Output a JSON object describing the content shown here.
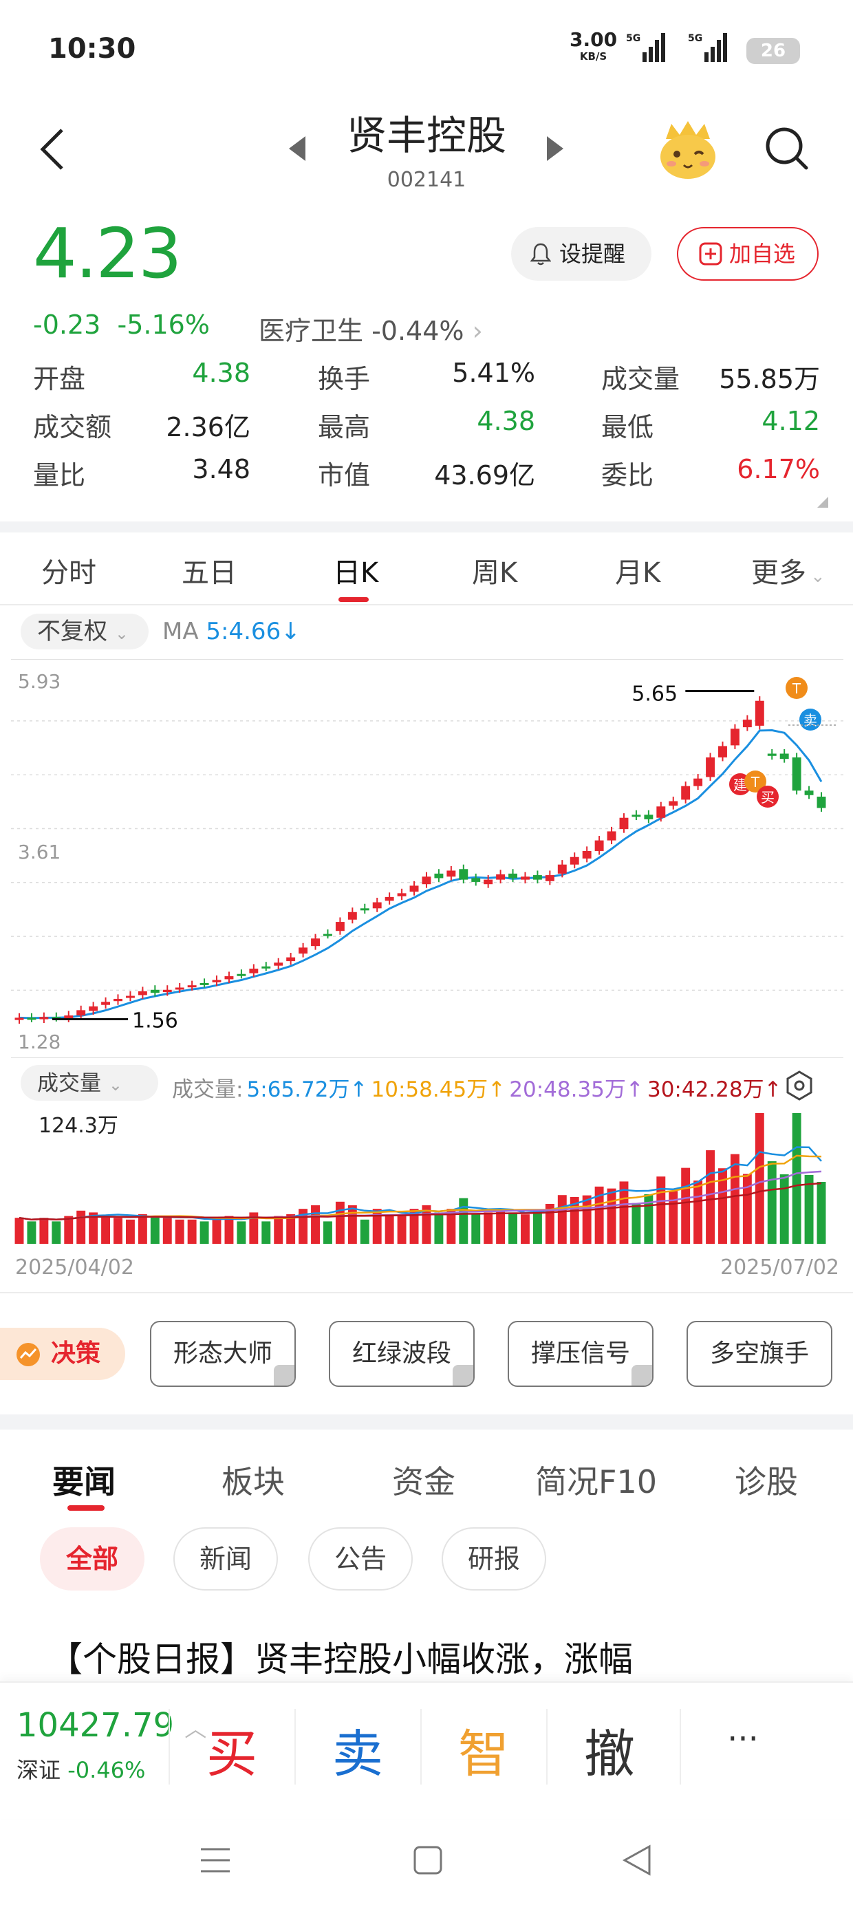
{
  "status_bar": {
    "time": "10:30",
    "speed": "3.00",
    "speed_unit": "KB/S",
    "net1": "5G",
    "net2": "5G",
    "battery": "26"
  },
  "header": {
    "title": "贤丰控股",
    "code": "002141"
  },
  "quote": {
    "price": "4.23",
    "change": "-0.23",
    "change_pct": "-5.16%",
    "sector": "医疗卫生 -0.44%",
    "remind_label": "设提醒",
    "add_label": "加自选"
  },
  "stats": [
    {
      "label": "开盘",
      "value": "4.38",
      "color": "#1fa33d"
    },
    {
      "label": "换手",
      "value": "5.41%",
      "color": "#222222"
    },
    {
      "label": "成交量",
      "value": "55.85万",
      "color": "#222222"
    },
    {
      "label": "成交额",
      "value": "2.36亿",
      "color": "#222222"
    },
    {
      "label": "最高",
      "value": "4.38",
      "color": "#1fa33d"
    },
    {
      "label": "最低",
      "value": "4.12",
      "color": "#1fa33d"
    },
    {
      "label": "量比",
      "value": "3.48",
      "color": "#222222"
    },
    {
      "label": "市值",
      "value": "43.69亿",
      "color": "#222222"
    },
    {
      "label": "委比",
      "value": "6.17%",
      "color": "#e5252e"
    }
  ],
  "period_tabs": [
    "分时",
    "五日",
    "日K",
    "周K",
    "月K",
    "更多"
  ],
  "active_period": "日K",
  "chart_controls": {
    "adjust": "不复权",
    "ma_label": "MA",
    "ma_value": "5:4.66↓"
  },
  "chart_data": {
    "type": "candlestick",
    "y_high_label": "5.93",
    "y_mid_label": "3.61",
    "y_low_label": "1.28",
    "ylim": [
      1.28,
      5.93
    ],
    "max_marker": "5.65",
    "min_marker": "1.56",
    "x_start": "2025/04/02",
    "x_end": "2025/07/02",
    "badges": [
      "T",
      "卖",
      "建",
      "T",
      "买"
    ],
    "close": [
      1.45,
      1.44,
      1.46,
      1.45,
      1.48,
      1.55,
      1.6,
      1.66,
      1.7,
      1.74,
      1.8,
      1.78,
      1.82,
      1.85,
      1.88,
      1.9,
      1.95,
      2.0,
      2.02,
      2.1,
      2.12,
      2.18,
      2.25,
      2.38,
      2.5,
      2.55,
      2.72,
      2.85,
      2.88,
      2.98,
      3.05,
      3.1,
      3.2,
      3.32,
      3.3,
      3.4,
      3.28,
      3.25,
      3.28,
      3.35,
      3.3,
      3.32,
      3.28,
      3.34,
      3.48,
      3.58,
      3.66,
      3.8,
      3.92,
      4.1,
      4.12,
      4.08,
      4.25,
      4.32,
      4.52,
      4.62,
      4.9,
      5.05,
      5.28,
      5.4,
      5.65,
      4.92,
      4.88,
      4.46,
      4.4,
      4.23
    ],
    "open": [
      1.42,
      1.45,
      1.43,
      1.46,
      1.44,
      1.48,
      1.54,
      1.62,
      1.67,
      1.72,
      1.75,
      1.82,
      1.79,
      1.83,
      1.86,
      1.91,
      1.92,
      1.96,
      2.03,
      2.04,
      2.13,
      2.14,
      2.2,
      2.3,
      2.4,
      2.56,
      2.6,
      2.75,
      2.9,
      2.9,
      3.0,
      3.06,
      3.12,
      3.22,
      3.36,
      3.32,
      3.42,
      3.3,
      3.22,
      3.28,
      3.36,
      3.28,
      3.34,
      3.26,
      3.36,
      3.48,
      3.56,
      3.66,
      3.8,
      3.95,
      4.14,
      4.14,
      4.1,
      4.26,
      4.34,
      4.52,
      4.64,
      4.9,
      5.06,
      5.3,
      5.32,
      4.95,
      4.95,
      4.9,
      4.46,
      4.38
    ],
    "volume_series": {
      "vol_ma_labels": [
        "5:65.72万↑",
        "10:58.45万↑",
        "20:48.35万↑",
        "30:42.28万↑"
      ],
      "max_label": "124.3万"
    }
  },
  "volume_header": {
    "label": "成交量",
    "prefix": "成交量:",
    "ma5": "5:65.72万↑",
    "ma10": "10:58.45万↑",
    "ma20": "20:48.35万↑",
    "ma30": "30:42.28万↑"
  },
  "strategy": {
    "badge": "决策",
    "items": [
      "形态大师",
      "红绿波段",
      "撑压信号",
      "多空旗手"
    ]
  },
  "news_tabs": [
    "要闻",
    "板块",
    "资金",
    "简况F10",
    "诊股"
  ],
  "news_filters": [
    "全部",
    "新闻",
    "公告",
    "研报"
  ],
  "headline": "【个股日报】贤丰控股小幅收涨，涨幅",
  "index_bar": {
    "value": "10427.79",
    "name": "深证",
    "change": "-0.46%"
  },
  "trade_buttons": [
    "买",
    "卖",
    "智",
    "撤",
    "···"
  ]
}
